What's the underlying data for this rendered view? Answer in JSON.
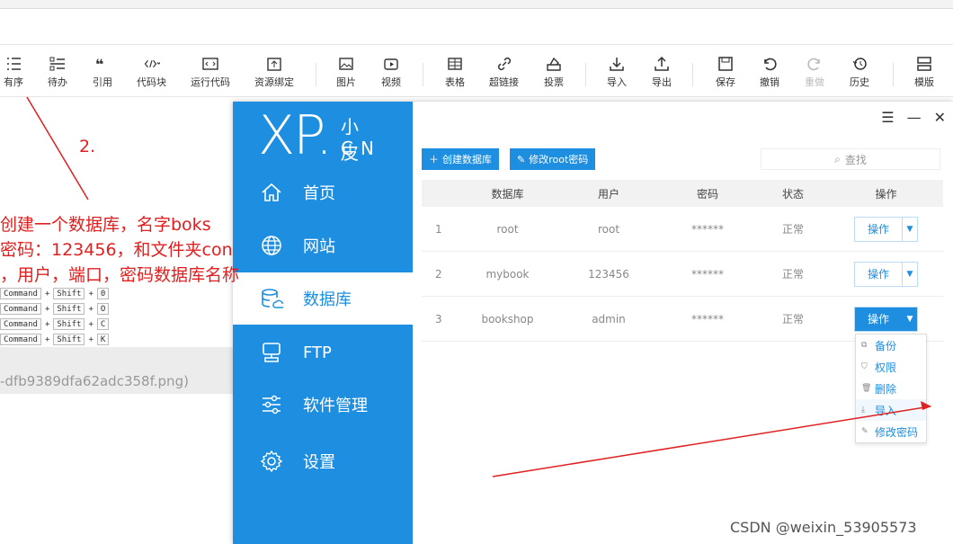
{
  "toolbar": {
    "items": [
      {
        "label": "有序",
        "icon": "ordered-list-icon"
      },
      {
        "label": "待办",
        "icon": "todo-list-icon"
      },
      {
        "label": "引用",
        "icon": "quote-icon"
      },
      {
        "label": "代码块",
        "icon": "code-block-icon"
      },
      {
        "label": "运行代码",
        "icon": "run-code-icon"
      },
      {
        "label": "资源绑定",
        "icon": "resource-bind-icon"
      },
      {
        "label": "图片",
        "icon": "image-icon"
      },
      {
        "label": "视频",
        "icon": "video-icon"
      },
      {
        "label": "表格",
        "icon": "table-icon"
      },
      {
        "label": "超链接",
        "icon": "link-icon"
      },
      {
        "label": "投票",
        "icon": "vote-icon"
      },
      {
        "label": "导入",
        "icon": "import-icon"
      },
      {
        "label": "导出",
        "icon": "export-icon"
      },
      {
        "label": "保存",
        "icon": "save-icon"
      },
      {
        "label": "撤销",
        "icon": "undo-icon"
      },
      {
        "label": "重做",
        "icon": "redo-icon"
      },
      {
        "label": "历史",
        "icon": "history-icon"
      },
      {
        "label": "模版",
        "icon": "template-icon"
      }
    ]
  },
  "annotation": {
    "step": "2.",
    "line1": "创建一个数据库，名字boks",
    "line2": "密码：123456，和文件夹con",
    "line3": "，用户，端口，密码数据库名称"
  },
  "background": {
    "filename": "-dfb9389dfa62adc358f.png)",
    "shortcut_key": "Command",
    "shortcut_shift": "Shift",
    "shortcut_letters": [
      "0",
      "O",
      "C",
      "K"
    ]
  },
  "app": {
    "logo_main": "XP.",
    "logo_cn1": "小皮",
    "logo_cn2": "CN",
    "nav": [
      {
        "label": "首页",
        "icon": "home-icon"
      },
      {
        "label": "网站",
        "icon": "globe-icon"
      },
      {
        "label": "数据库",
        "icon": "database-icon"
      },
      {
        "label": "FTP",
        "icon": "ftp-icon"
      },
      {
        "label": "软件管理",
        "icon": "software-settings-icon"
      },
      {
        "label": "设置",
        "icon": "gear-icon"
      }
    ],
    "create_db": "创建数据库",
    "modify_root": "修改root密码",
    "search_placeholder": "查找",
    "headers": [
      "数据库",
      "用户",
      "密码",
      "状态",
      "操作"
    ],
    "rows": [
      {
        "idx": "1",
        "db": "root",
        "user": "root",
        "pwd": "******",
        "status": "正常",
        "op": "操作"
      },
      {
        "idx": "2",
        "db": "mybook",
        "user": "123456",
        "pwd": "******",
        "status": "正常",
        "op": "操作"
      },
      {
        "idx": "3",
        "db": "bookshop",
        "user": "admin",
        "pwd": "******",
        "status": "正常",
        "op": "操作"
      }
    ],
    "menu": [
      "备份",
      "权限",
      "删除",
      "导入",
      "修改密码"
    ]
  },
  "watermark": "CSDN @weixin_53905573",
  "colors": {
    "accent": "#1e8ee0",
    "annotation": "#e02020"
  }
}
